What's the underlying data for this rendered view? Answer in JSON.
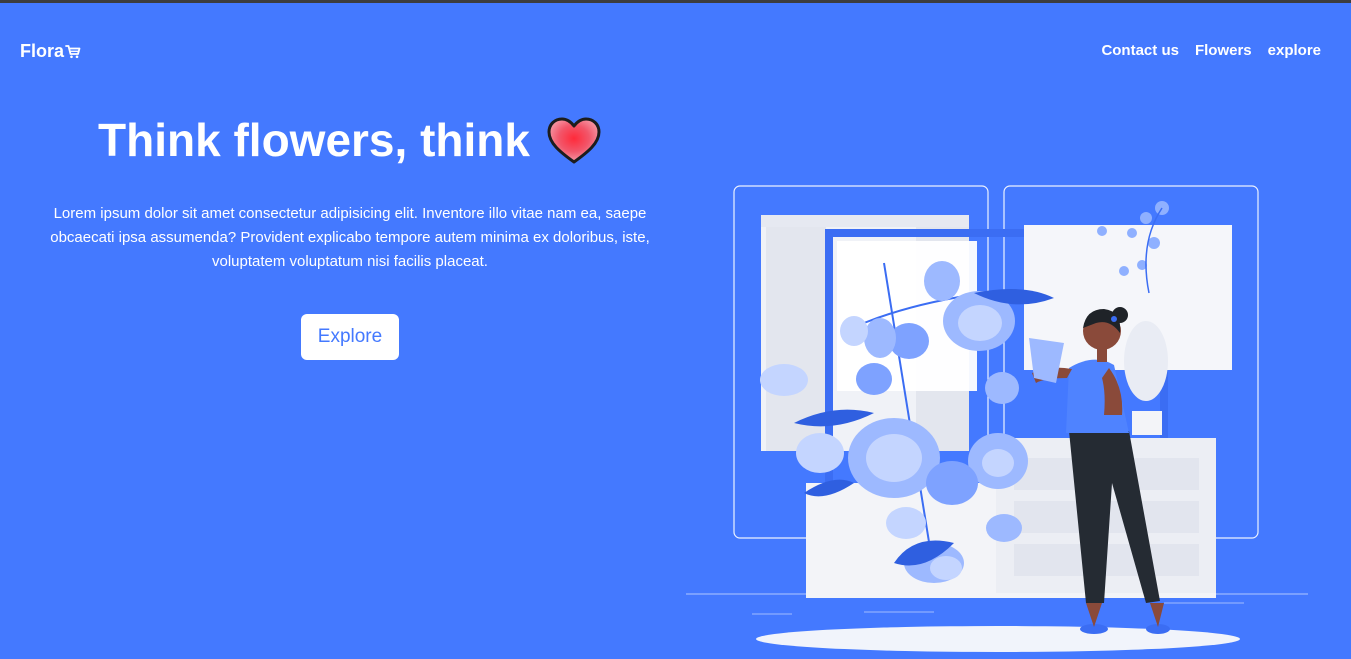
{
  "nav": {
    "brand": "Flora",
    "brand_icon": "cart-icon",
    "links": [
      {
        "label": "Contact us"
      },
      {
        "label": "Flowers"
      },
      {
        "label": "explore"
      }
    ]
  },
  "hero": {
    "title": "Think flowers, think",
    "title_icon": "heart-icon",
    "text": "Lorem ipsum dolor sit amet consectetur adipisicing elit. Inventore illo vitae nam ea, saepe obcaecati ipsa assumenda? Provident explicabo tempore autem minima ex doloribus, iste, voluptatem voluptatum nisi facilis placeat.",
    "button_label": "Explore"
  },
  "illustration": "woman-watering-flowers-illustration",
  "colors": {
    "background": "#4479ff",
    "text": "#ffffff",
    "button_text": "#4479ff",
    "heart": "#f23d4f"
  }
}
